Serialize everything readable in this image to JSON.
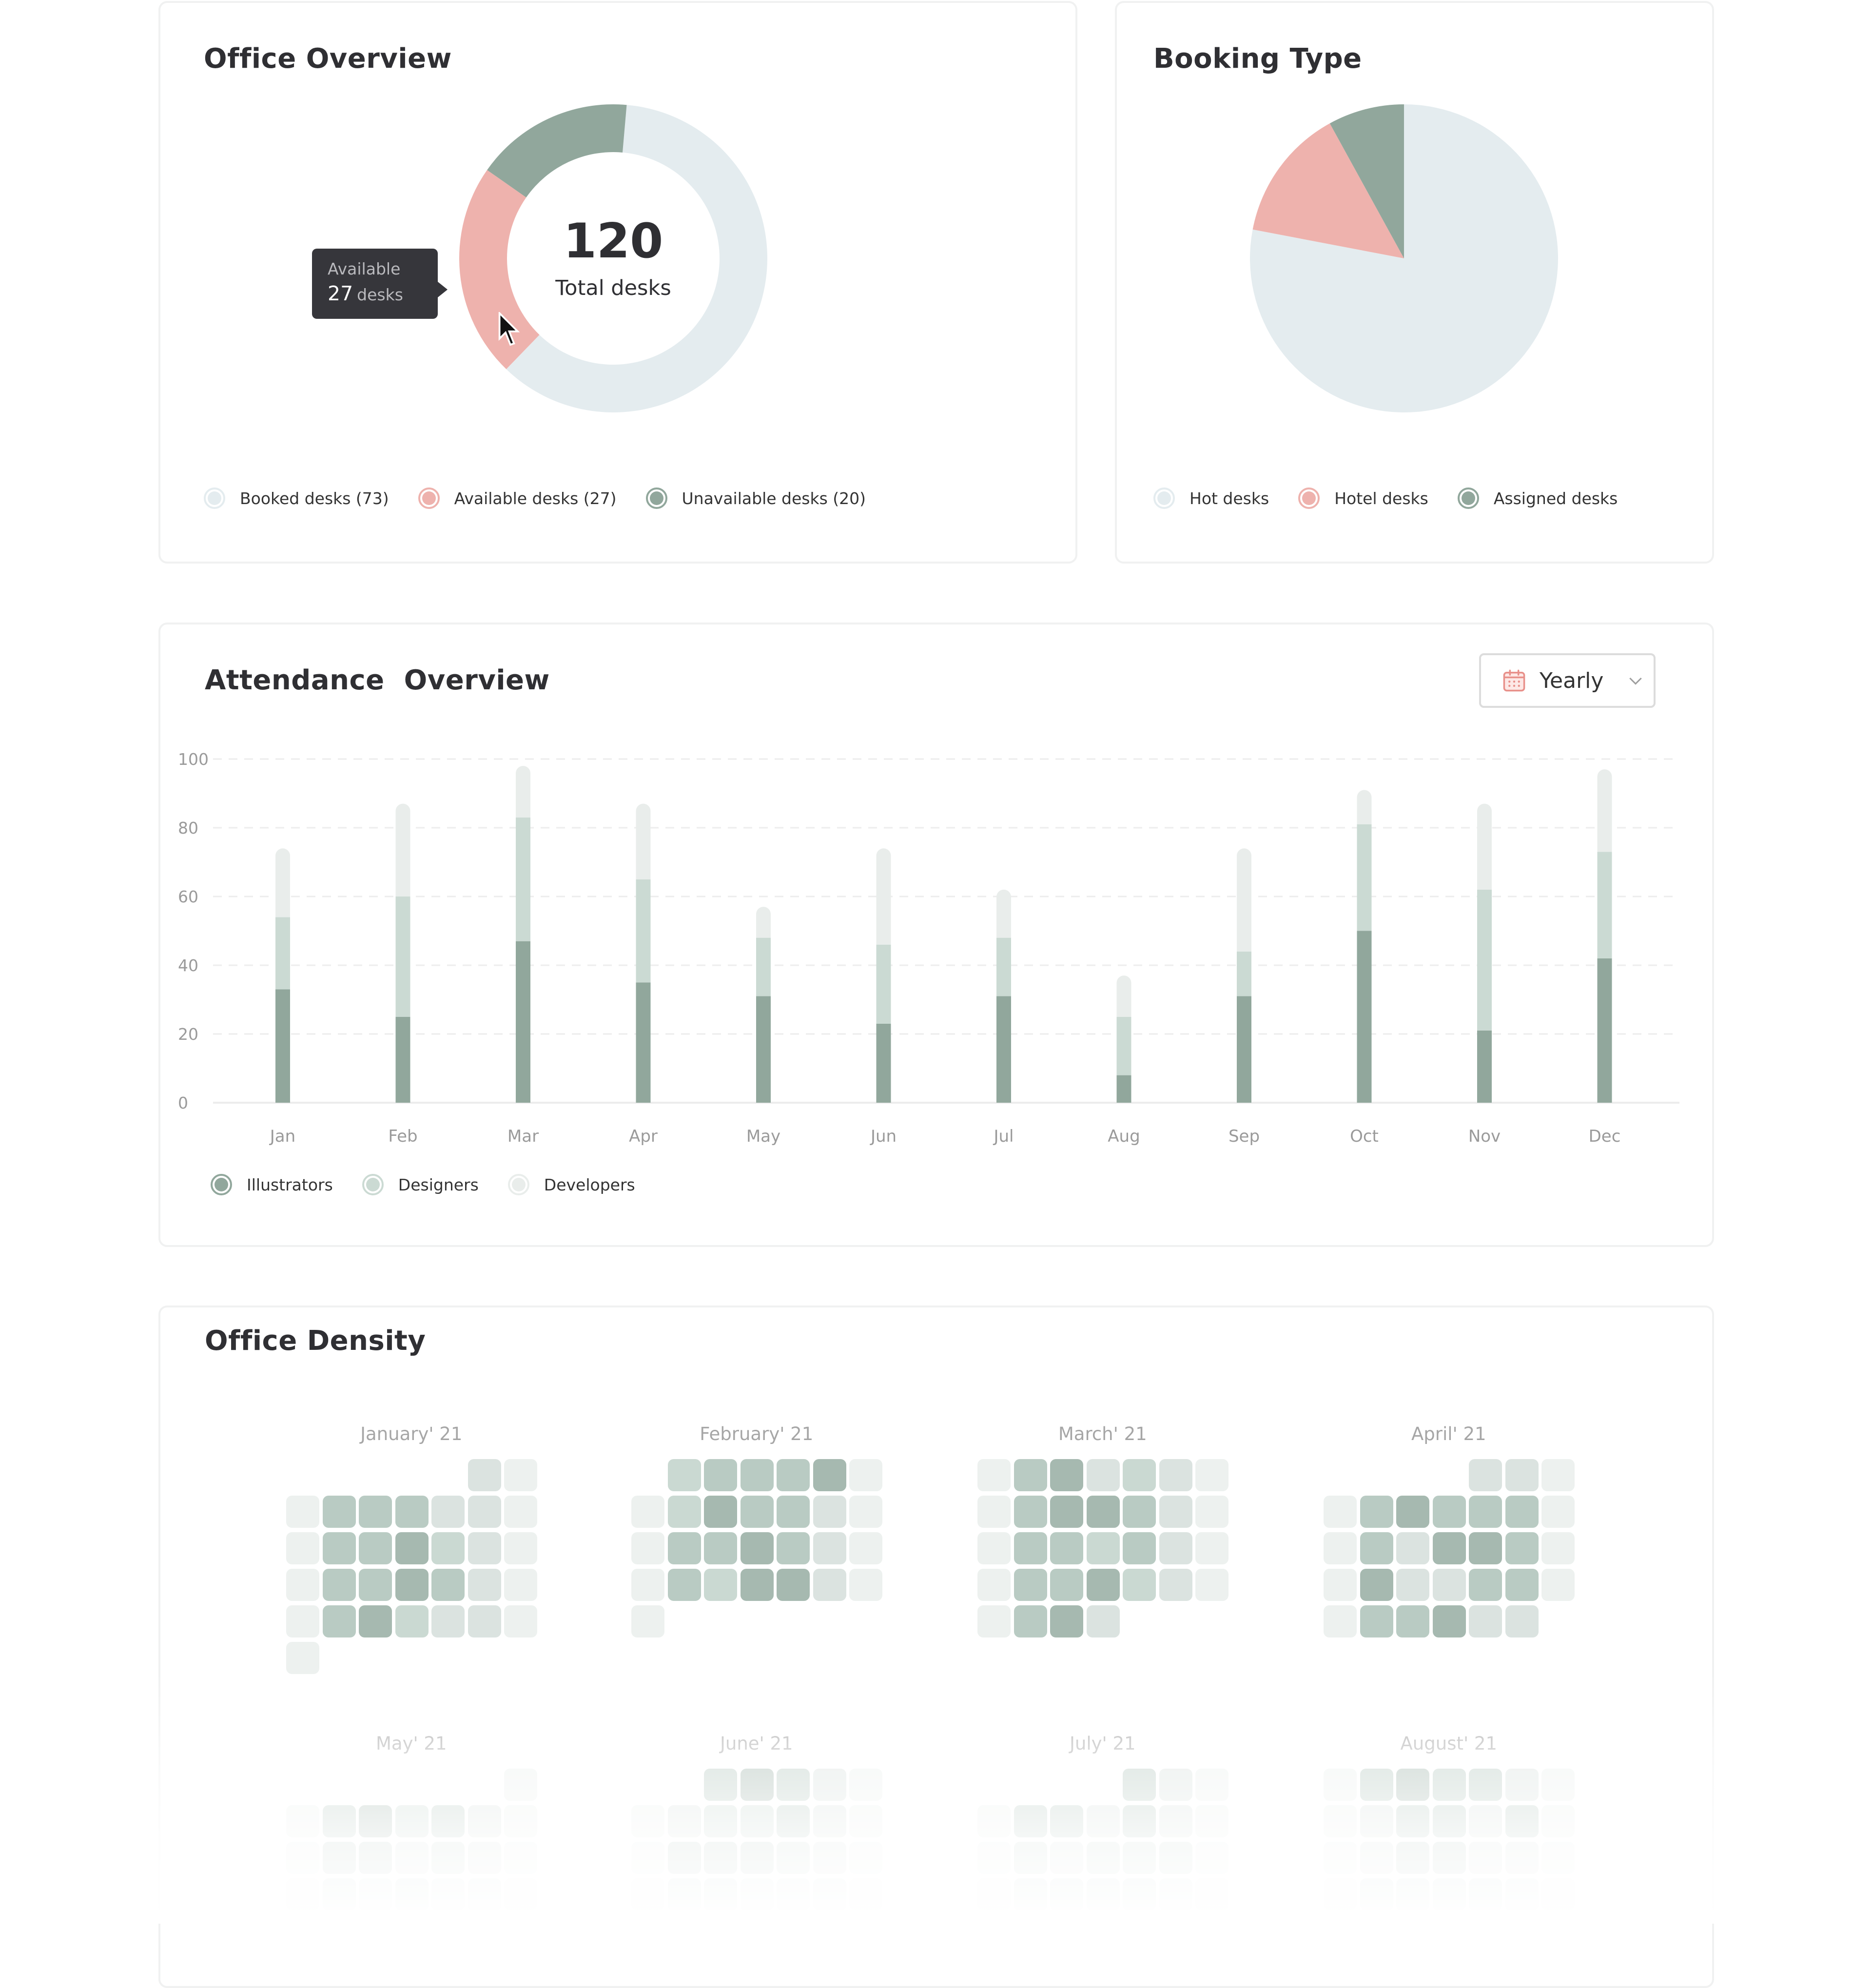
{
  "office_overview": {
    "title": "Office Overview",
    "center_value": "120",
    "center_label": "Total desks",
    "tooltip": {
      "label": "Available",
      "value": "27",
      "unit": "desks"
    },
    "legend": [
      {
        "label": "Booked desks (73)",
        "color": "#e4ecef"
      },
      {
        "label": "Available desks (27)",
        "color": "#eeb2ad"
      },
      {
        "label": "Unavailable desks (20)",
        "color": "#91a79c"
      }
    ]
  },
  "booking_type": {
    "title": "Booking Type",
    "legend": [
      {
        "label": "Hot desks",
        "color": "#e4ecef"
      },
      {
        "label": "Hotel desks",
        "color": "#eeb2ad"
      },
      {
        "label": "Assigned desks",
        "color": "#91a79c"
      }
    ]
  },
  "attendance": {
    "title": "Attendance  Overview",
    "period_selector": {
      "value": "Yearly",
      "icon": "calendar-icon"
    },
    "legend": [
      {
        "label": "Illustrators",
        "color": "#91a79c"
      },
      {
        "label": "Designers",
        "color": "#cbdad3"
      },
      {
        "label": "Developers",
        "color": "#e9edeb"
      }
    ]
  },
  "density": {
    "title": "Office Density",
    "levels": [
      "#edf1ef",
      "#dbe3e0",
      "#cad9d2",
      "#b9cbc3",
      "#a6b9b0"
    ],
    "months": [
      {
        "name": "January' 21",
        "rows": [
          [
            null,
            null,
            null,
            null,
            null,
            1,
            0
          ],
          [
            0,
            3,
            3,
            3,
            1,
            1,
            0
          ],
          [
            0,
            3,
            3,
            4,
            2,
            1,
            0
          ],
          [
            0,
            3,
            3,
            4,
            3,
            1,
            0
          ],
          [
            0,
            3,
            4,
            2,
            1,
            1,
            0
          ],
          [
            0
          ]
        ]
      },
      {
        "name": "February' 21",
        "rows": [
          [
            null,
            2,
            3,
            3,
            3,
            4,
            0
          ],
          [
            0,
            2,
            4,
            3,
            3,
            1,
            0
          ],
          [
            0,
            3,
            3,
            4,
            3,
            1,
            0
          ],
          [
            0,
            3,
            2,
            4,
            4,
            1,
            0
          ],
          [
            0
          ]
        ]
      },
      {
        "name": "March' 21",
        "rows": [
          [
            0,
            3,
            4,
            1,
            2,
            1,
            0
          ],
          [
            0,
            3,
            4,
            4,
            3,
            1,
            0
          ],
          [
            0,
            3,
            3,
            2,
            3,
            1,
            0
          ],
          [
            0,
            3,
            3,
            4,
            2,
            1,
            0
          ],
          [
            0,
            3,
            4,
            1
          ]
        ]
      },
      {
        "name": "April' 21",
        "rows": [
          [
            null,
            null,
            null,
            null,
            1,
            1,
            0
          ],
          [
            0,
            3,
            4,
            3,
            3,
            3,
            0
          ],
          [
            0,
            3,
            1,
            4,
            4,
            3,
            0
          ],
          [
            0,
            4,
            1,
            1,
            3,
            3,
            0
          ],
          [
            0,
            3,
            3,
            4,
            1,
            1
          ]
        ]
      },
      {
        "name": "May' 21",
        "rows": [
          [
            null,
            null,
            null,
            null,
            null,
            null,
            0
          ],
          [
            0,
            3,
            4,
            2,
            3,
            1,
            0
          ],
          [
            0,
            3,
            3,
            1,
            2,
            1,
            0
          ],
          [
            0,
            2,
            1,
            2,
            1,
            1,
            0
          ]
        ]
      },
      {
        "name": "June' 21",
        "rows": [
          [
            null,
            null,
            3,
            4,
            3,
            1,
            0
          ],
          [
            0,
            1,
            2,
            2,
            3,
            1,
            0
          ],
          [
            0,
            3,
            3,
            3,
            2,
            1,
            0
          ],
          [
            0,
            2,
            2,
            1,
            1,
            1,
            0
          ]
        ]
      },
      {
        "name": "July' 21",
        "rows": [
          [
            null,
            null,
            null,
            null,
            3,
            1,
            0
          ],
          [
            0,
            3,
            3,
            1,
            3,
            1,
            0
          ],
          [
            0,
            2,
            1,
            2,
            2,
            2,
            0
          ],
          [
            0,
            2,
            2,
            2,
            2,
            1,
            0
          ]
        ]
      },
      {
        "name": "August' 21",
        "rows": [
          [
            0,
            3,
            4,
            3,
            3,
            1,
            0
          ],
          [
            0,
            1,
            3,
            3,
            1,
            3,
            0
          ],
          [
            0,
            1,
            3,
            3,
            1,
            1,
            0
          ],
          [
            0,
            2,
            2,
            2,
            2,
            1,
            0
          ]
        ]
      }
    ]
  },
  "chart_data": [
    {
      "type": "pie",
      "title": "Office Overview",
      "variant": "donut",
      "center_text": "120 Total desks",
      "categories": [
        "Booked desks",
        "Available desks",
        "Unavailable desks"
      ],
      "values": [
        73,
        27,
        20
      ],
      "colors": [
        "#e4ecef",
        "#eeb2ad",
        "#91a79c"
      ],
      "start_angle_deg": 5,
      "legend": "bottom-left"
    },
    {
      "type": "pie",
      "title": "Booking Type",
      "categories": [
        "Hot desks",
        "Hotel desks",
        "Assigned desks"
      ],
      "values": [
        78,
        14,
        8
      ],
      "colors": [
        "#e4ecef",
        "#eeb2ad",
        "#91a79c"
      ],
      "legend": "bottom-left"
    },
    {
      "type": "bar",
      "stacked": true,
      "title": "Attendance  Overview",
      "xlabel": "",
      "ylabel": "",
      "categories": [
        "Jan",
        "Feb",
        "Mar",
        "Apr",
        "May",
        "Jun",
        "Jul",
        "Aug",
        "Sep",
        "Oct",
        "Nov",
        "Dec"
      ],
      "series": [
        {
          "name": "Illustrators",
          "color": "#91a79c",
          "values": [
            33,
            25,
            47,
            35,
            31,
            23,
            31,
            8,
            31,
            50,
            21,
            42
          ]
        },
        {
          "name": "Designers",
          "color": "#cbdad3",
          "values": [
            21,
            35,
            36,
            30,
            17,
            23,
            17,
            17,
            13,
            31,
            41,
            31
          ]
        },
        {
          "name": "Developers",
          "color": "#e9edeb",
          "values": [
            20,
            27,
            15,
            22,
            9,
            28,
            14,
            12,
            30,
            10,
            25,
            24
          ]
        }
      ],
      "ylim": [
        0,
        100
      ],
      "yticks": [
        0,
        20,
        40,
        60,
        80,
        100
      ],
      "grid": true,
      "legend": "bottom-left"
    },
    {
      "type": "heatmap",
      "title": "Office Density",
      "note": "Calendar heatmaps per month; levels 0 (lowest) to 4 (highest), see density.months"
    }
  ]
}
